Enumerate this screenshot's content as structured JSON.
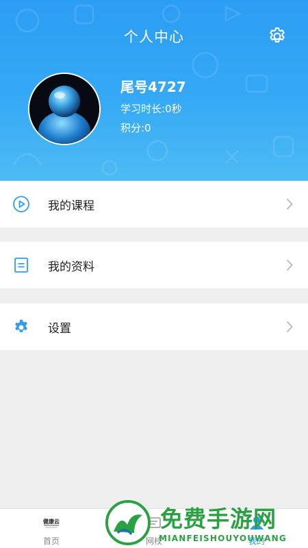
{
  "header": {
    "title": "个人中心",
    "settings_icon": "gear-icon",
    "background_color": "#35a9f5"
  },
  "profile": {
    "name": "尾号4727",
    "study_time": "学习时长:0秒",
    "points": "积分:0"
  },
  "menu": [
    {
      "label": "我的课程",
      "icon": "play-circle-icon",
      "icon_color": "#2d9cf2"
    },
    {
      "label": "我的资料",
      "icon": "document-icon",
      "icon_color": "#2d9cf2"
    },
    {
      "label": "设置",
      "icon": "gear-icon",
      "icon_color": "#2d9cf2"
    }
  ],
  "tabbar": {
    "items": [
      {
        "label": "首页",
        "icon": "home-logo-icon"
      },
      {
        "label": "网校",
        "icon": "school-icon"
      },
      {
        "label": "我的",
        "icon": "user-icon",
        "active": true
      }
    ],
    "active_color": "#2d9cf2"
  },
  "watermark": {
    "text": "免费手游网",
    "subtext": "MIANFEISHOUYOUWANG",
    "color": "#2aa244"
  }
}
